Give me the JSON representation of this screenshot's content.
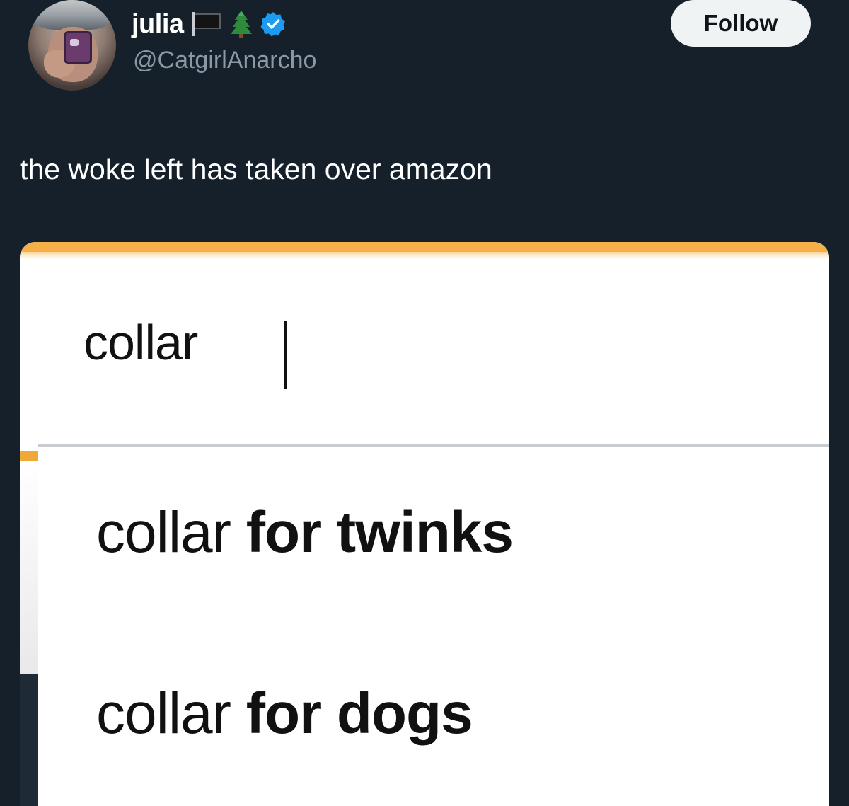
{
  "tweet": {
    "display_name": "julia",
    "handle": "@CatgirlAnarcho",
    "follow_label": "Follow",
    "text": "the woke left has taken over amazon",
    "name_icons": [
      "black-flag-icon",
      "evergreen-tree-icon",
      "verified-badge-icon"
    ]
  },
  "screenshot": {
    "search_query": "collar",
    "suggestions": [
      {
        "prefix": "collar",
        "completion": " for twinks"
      },
      {
        "prefix": "collar",
        "completion": " for dogs"
      }
    ]
  },
  "colors": {
    "background": "#15202b",
    "follow_button": "#eff3f4",
    "verified": "#1d9bf0",
    "amazon_orange": "#f5b04a"
  }
}
